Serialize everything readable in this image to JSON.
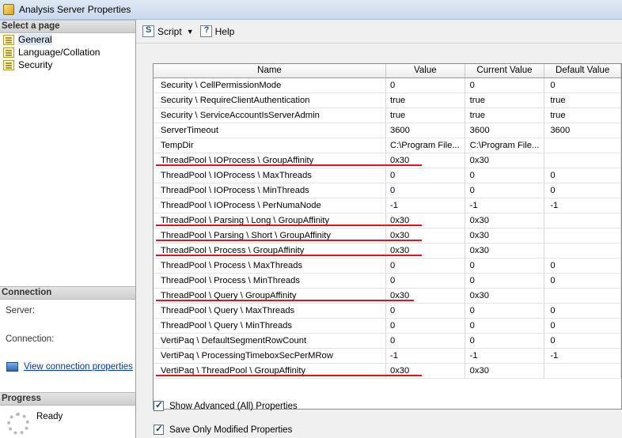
{
  "window": {
    "title": "Analysis Server Properties"
  },
  "left": {
    "select_page_header": "Select a page",
    "pages": [
      {
        "label": "General",
        "selected": true
      },
      {
        "label": "Language/Collation",
        "selected": false
      },
      {
        "label": "Security",
        "selected": false
      }
    ],
    "connection_header": "Connection",
    "server_label": "Server:",
    "connection_label": "Connection:",
    "view_connection_link": "View connection properties",
    "progress_header": "Progress",
    "progress_status": "Ready"
  },
  "toolbar": {
    "script_label": "Script",
    "help_label": "Help"
  },
  "grid": {
    "columns": [
      "Name",
      "Value",
      "Current Value",
      "Default Value"
    ],
    "rows": [
      [
        "Security \\ CellPermissionMode",
        "0",
        "0",
        "0"
      ],
      [
        "Security \\ RequireClientAuthentication",
        "true",
        "true",
        "true"
      ],
      [
        "Security \\ ServiceAccountIsServerAdmin",
        "true",
        "true",
        "true"
      ],
      [
        "ServerTimeout",
        "3600",
        "3600",
        "3600"
      ],
      [
        "TempDir",
        "C:\\Program File...",
        "C:\\Program File...",
        ""
      ],
      [
        "ThreadPool \\ IOProcess \\ GroupAffinity",
        "0x30",
        "0x30",
        ""
      ],
      [
        "ThreadPool \\ IOProcess \\ MaxThreads",
        "0",
        "0",
        "0"
      ],
      [
        "ThreadPool \\ IOProcess \\ MinThreads",
        "0",
        "0",
        "0"
      ],
      [
        "ThreadPool \\ IOProcess \\ PerNumaNode",
        "-1",
        "-1",
        "-1"
      ],
      [
        "ThreadPool \\ Parsing \\ Long \\ GroupAffinity",
        "0x30",
        "0x30",
        ""
      ],
      [
        "ThreadPool \\ Parsing \\ Short \\ GroupAffinity",
        "0x30",
        "0x30",
        ""
      ],
      [
        "ThreadPool \\ Process \\ GroupAffinity",
        "0x30",
        "0x30",
        ""
      ],
      [
        "ThreadPool \\ Process \\ MaxThreads",
        "0",
        "0",
        "0"
      ],
      [
        "ThreadPool \\ Process \\ MinThreads",
        "0",
        "0",
        "0"
      ],
      [
        "ThreadPool \\ Query \\ GroupAffinity",
        "0x30",
        "0x30",
        ""
      ],
      [
        "ThreadPool \\ Query \\ MaxThreads",
        "0",
        "0",
        "0"
      ],
      [
        "ThreadPool \\ Query \\ MinThreads",
        "0",
        "0",
        "0"
      ],
      [
        "VertiPaq \\ DefaultSegmentRowCount",
        "0",
        "0",
        "0"
      ],
      [
        "VertiPaq \\ ProcessingTimeboxSecPerMRow",
        "-1",
        "-1",
        "-1"
      ],
      [
        "VertiPaq \\ ThreadPool \\ GroupAffinity",
        "0x30",
        "0x30",
        ""
      ]
    ]
  },
  "options": {
    "show_advanced_label": "Show Advanced (All) Properties",
    "show_advanced_checked": true,
    "save_only_modified_label": "Save Only Modified Properties",
    "save_only_modified_checked": true
  },
  "annotation_color": "#e0141e"
}
